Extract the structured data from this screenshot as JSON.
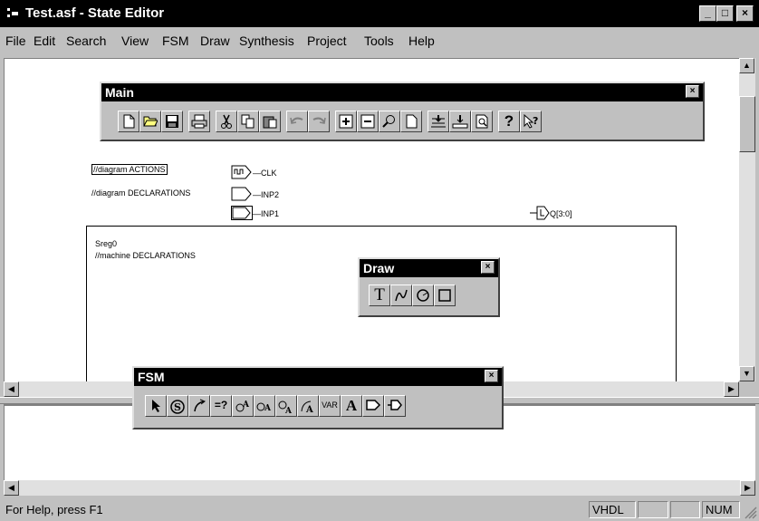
{
  "window": {
    "title": "Test.asf - State Editor",
    "controls": {
      "minimize": "_",
      "maximize": "□",
      "close": "×"
    }
  },
  "menu": [
    {
      "label": "File"
    },
    {
      "label": "Edit"
    },
    {
      "label": "Search"
    },
    {
      "label": "View"
    },
    {
      "label": "FSM"
    },
    {
      "label": "Draw"
    },
    {
      "label": "Synthesis"
    },
    {
      "label": "Project"
    },
    {
      "label": "Tools"
    },
    {
      "label": "Help"
    }
  ],
  "diagram": {
    "actions_label": "//diagram ACTIONS",
    "declarations_label": "//diagram DECLARATIONS",
    "ports": {
      "clk": "CLK",
      "inp2": "INP2",
      "inp1": "INP1",
      "output": "Q[3:0]"
    },
    "machine": {
      "name": "Sreg0",
      "declarations": "//machine DECLARATIONS"
    }
  },
  "toolbars": {
    "main": {
      "title": "Main"
    },
    "draw": {
      "title": "Draw",
      "text_tool": "T"
    },
    "fsm": {
      "title": "FSM",
      "compare_label": "=?",
      "var_label": "VAR",
      "text_tool": "A",
      "glyph_a": "A"
    }
  },
  "statusbar": {
    "help_text": "For Help, press F1",
    "language": "VHDL",
    "num": "NUM"
  }
}
